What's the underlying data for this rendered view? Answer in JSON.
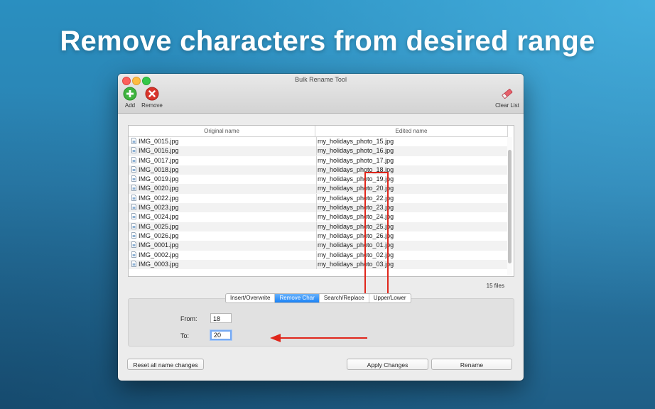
{
  "headline": "Remove characters from desired range",
  "window": {
    "title": "Bulk Rename Tool",
    "toolbar": {
      "add_label": "Add",
      "remove_label": "Remove",
      "clear_label": "Clear List"
    }
  },
  "table": {
    "col_original": "Original name",
    "col_edited": "Edited name",
    "rows": [
      {
        "original": "IMG_0015.jpg",
        "edited": "my_holidays_photo_15.jpg"
      },
      {
        "original": "IMG_0016.jpg",
        "edited": "my_holidays_photo_16.jpg"
      },
      {
        "original": "IMG_0017.jpg",
        "edited": "my_holidays_photo_17.jpg"
      },
      {
        "original": "IMG_0018.jpg",
        "edited": "my_holidays_photo_18.jpg"
      },
      {
        "original": "IMG_0019.jpg",
        "edited": "my_holidays_photo_19.jpg"
      },
      {
        "original": "IMG_0020.jpg",
        "edited": "my_holidays_photo_20.jpg"
      },
      {
        "original": "IMG_0022.jpg",
        "edited": "my_holidays_photo_22.jpg"
      },
      {
        "original": "IMG_0023.jpg",
        "edited": "my_holidays_photo_23.jpg"
      },
      {
        "original": "IMG_0024.jpg",
        "edited": "my_holidays_photo_24.jpg"
      },
      {
        "original": "IMG_0025.jpg",
        "edited": "my_holidays_photo_25.jpg"
      },
      {
        "original": "IMG_0026.jpg",
        "edited": "my_holidays_photo_26.jpg"
      },
      {
        "original": "IMG_0001.jpg",
        "edited": "my_holidays_photo_01.jpg"
      },
      {
        "original": "IMG_0002.jpg",
        "edited": "my_holidays_photo_02.jpg"
      },
      {
        "original": "IMG_0003.jpg",
        "edited": "my_holidays_photo_03.jpg"
      }
    ],
    "count": "15 files"
  },
  "tabs": [
    "Insert/Overwrite",
    "Remove Char",
    "Search/Replace",
    "Upper/Lower"
  ],
  "active_tab": "Remove Char",
  "form": {
    "from_label": "From:",
    "from_value": "18",
    "to_label": "To:",
    "to_value": "20"
  },
  "buttons": {
    "reset": "Reset all name changes",
    "apply": "Apply Changes",
    "rename": "Rename"
  },
  "colors": {
    "accent": "#1a82f6",
    "highlight": "#e0261b",
    "add_icon": "#3fb43f",
    "remove_icon": "#d9352b"
  },
  "icons": {
    "add": "plus-circle-icon",
    "remove": "x-circle-icon",
    "clear": "eraser-icon",
    "file": "file-icon"
  }
}
